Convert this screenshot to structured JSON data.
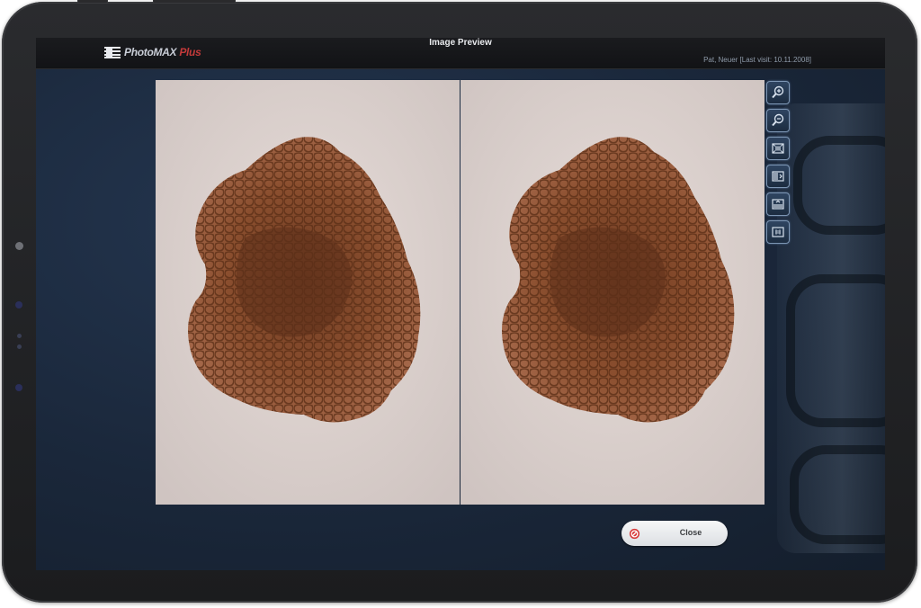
{
  "app": {
    "logo_name": "PhotoMAX",
    "logo_suffix": "Plus",
    "window_title": "Image Preview",
    "patient_info": "Pat, Neuer [Last visit: 10.11.2008]"
  },
  "toolbar": {
    "tools": [
      {
        "icon": "zoom-in-icon"
      },
      {
        "icon": "zoom-out-icon"
      },
      {
        "icon": "fit-screen-icon"
      },
      {
        "icon": "compare-left-icon"
      },
      {
        "icon": "compare-split-icon"
      },
      {
        "icon": "actual-size-icon"
      }
    ]
  },
  "actions": {
    "close_label": "Close",
    "close_icon": "no-entry-icon"
  },
  "colors": {
    "accent_red": "#c33a3a",
    "screen_bg": "#1e2a3c",
    "skin": "#dcd2cf",
    "lesion": "#6b3a20"
  }
}
